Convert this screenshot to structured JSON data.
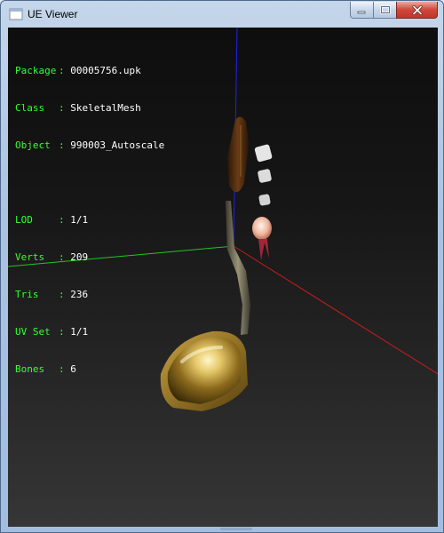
{
  "window": {
    "title": "UE Viewer"
  },
  "info": {
    "package": {
      "label": "Package",
      "value": "00005756.upk"
    },
    "class": {
      "label": "Class  ",
      "value": "SkeletalMesh"
    },
    "object": {
      "label": "Object ",
      "value": "990003_Autoscale"
    },
    "lod": {
      "label": "LOD    ",
      "value": "1/1"
    },
    "verts": {
      "label": "Verts  ",
      "value": "209"
    },
    "tris": {
      "label": "Tris   ",
      "value": "236"
    },
    "uvset": {
      "label": "UV Set ",
      "value": "1/1"
    },
    "bones": {
      "label": "Bones  ",
      "value": "6"
    },
    "separator": ": "
  },
  "colors": {
    "label_green": "#33ff33",
    "axis_x": "#cc1b1b",
    "axis_y": "#1fc81f",
    "axis_z": "#2222ee"
  },
  "icons": {
    "app": "ue-viewer-app-icon",
    "minimize": "minimize-icon",
    "maximize": "maximize-icon",
    "close": "close-icon"
  }
}
